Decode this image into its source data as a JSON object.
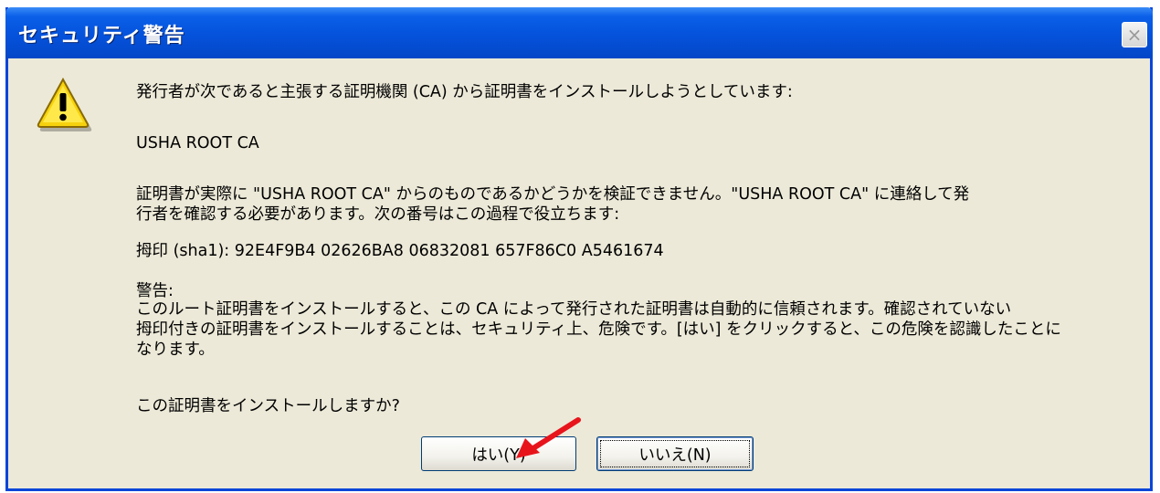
{
  "window": {
    "title": "セキュリティ警告",
    "close_glyph": "×"
  },
  "message": {
    "intro": "発行者が次であると主張する証明機関 (CA) から証明書をインストールしようとしています:",
    "ca_name": "USHA ROOT CA",
    "verify": "証明書が実際に \"USHA ROOT CA\" からのものであるかどうかを検証できません。\"USHA ROOT CA\" に連絡して発\n行者を確認する必要があります。次の番号はこの過程で役立ちます:",
    "thumbprint": "拇印 (sha1): 92E4F9B4 02626BA8 06832081 657F86C0 A5461674",
    "warning_heading": "警告:",
    "warning_body": "このルート証明書をインストールすると、この CA によって発行された証明書は自動的に信頼されます。確認されていない\n拇印付きの証明書をインストールすることは、セキュリティ上、危険です。[はい] をクリックすると、この危険を認識したことに\nなります。",
    "question": "この証明書をインストールしますか?"
  },
  "buttons": {
    "yes": "はい(Y)",
    "no": "いいえ(N)"
  },
  "icons": {
    "warning": "warning-triangle-icon",
    "annotation_arrow": "red-arrow-icon"
  },
  "colors": {
    "titlebar": "#0552db",
    "dialog_bg": "#ece9d8",
    "arrow": "#e8141c"
  }
}
